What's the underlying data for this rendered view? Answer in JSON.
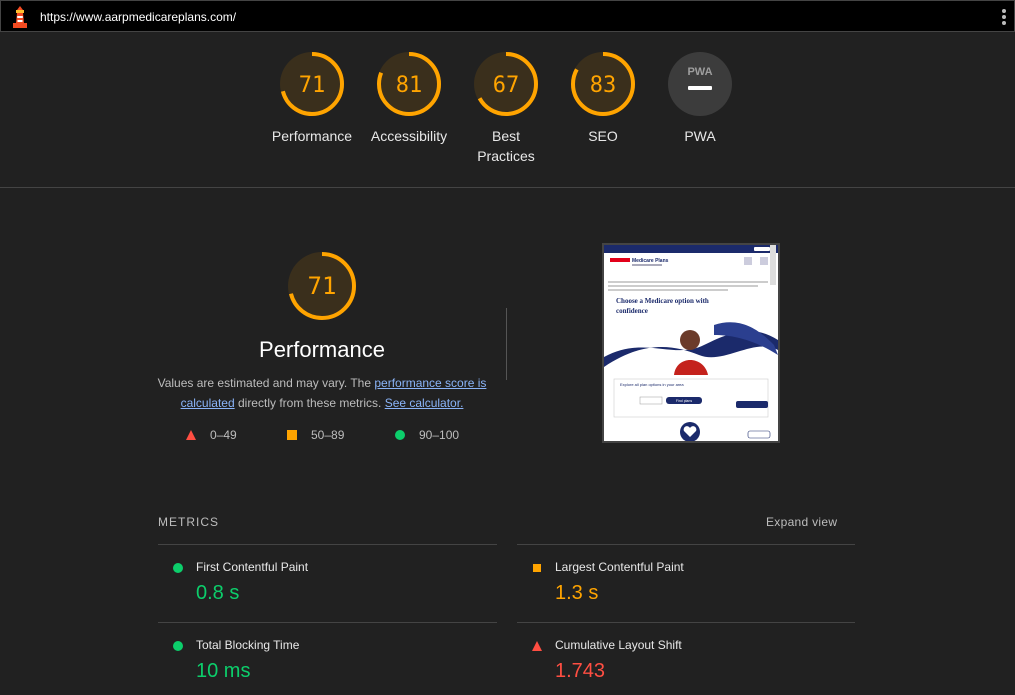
{
  "topbar": {
    "url": "https://www.aarpmedicareplans.com/"
  },
  "categories": [
    {
      "score": "71",
      "label": "Performance",
      "value": 0.71,
      "color": "#ffa400"
    },
    {
      "score": "81",
      "label": "Accessibility",
      "value": 0.81,
      "color": "#ffa400"
    },
    {
      "score": "67",
      "label": "Best Practices",
      "value": 0.67,
      "color": "#ffa400"
    },
    {
      "score": "83",
      "label": "SEO",
      "value": 0.83,
      "color": "#ffa400"
    },
    {
      "badge": "PWA",
      "label": "PWA"
    }
  ],
  "performance": {
    "score": "71",
    "value": 0.71,
    "title": "Performance",
    "desc_before": "Values are estimated and may vary. The ",
    "link1": "performance score is calculated",
    "desc_middle": " directly from these metrics. ",
    "link2": "See calculator."
  },
  "legend": {
    "fail": "0–49",
    "average": "50–89",
    "pass": "90–100"
  },
  "screenshot": {
    "heading": "Choose a Medicare option with confidence",
    "brand": "Medicare Plans",
    "find_plans": "Find plans",
    "explore": "Explore all plan options in your area"
  },
  "metrics": {
    "title": "METRICS",
    "expand": "Expand view",
    "items": [
      {
        "name": "First Contentful Paint",
        "value": "0.8 s",
        "status": "pass"
      },
      {
        "name": "Largest Contentful Paint",
        "value": "1.3 s",
        "status": "average"
      },
      {
        "name": "Total Blocking Time",
        "value": "10 ms",
        "status": "pass"
      },
      {
        "name": "Cumulative Layout Shift",
        "value": "1.743",
        "status": "fail"
      }
    ]
  },
  "colors": {
    "pass": "#0cce6b",
    "average": "#ffa400",
    "fail": "#ff4e42"
  }
}
